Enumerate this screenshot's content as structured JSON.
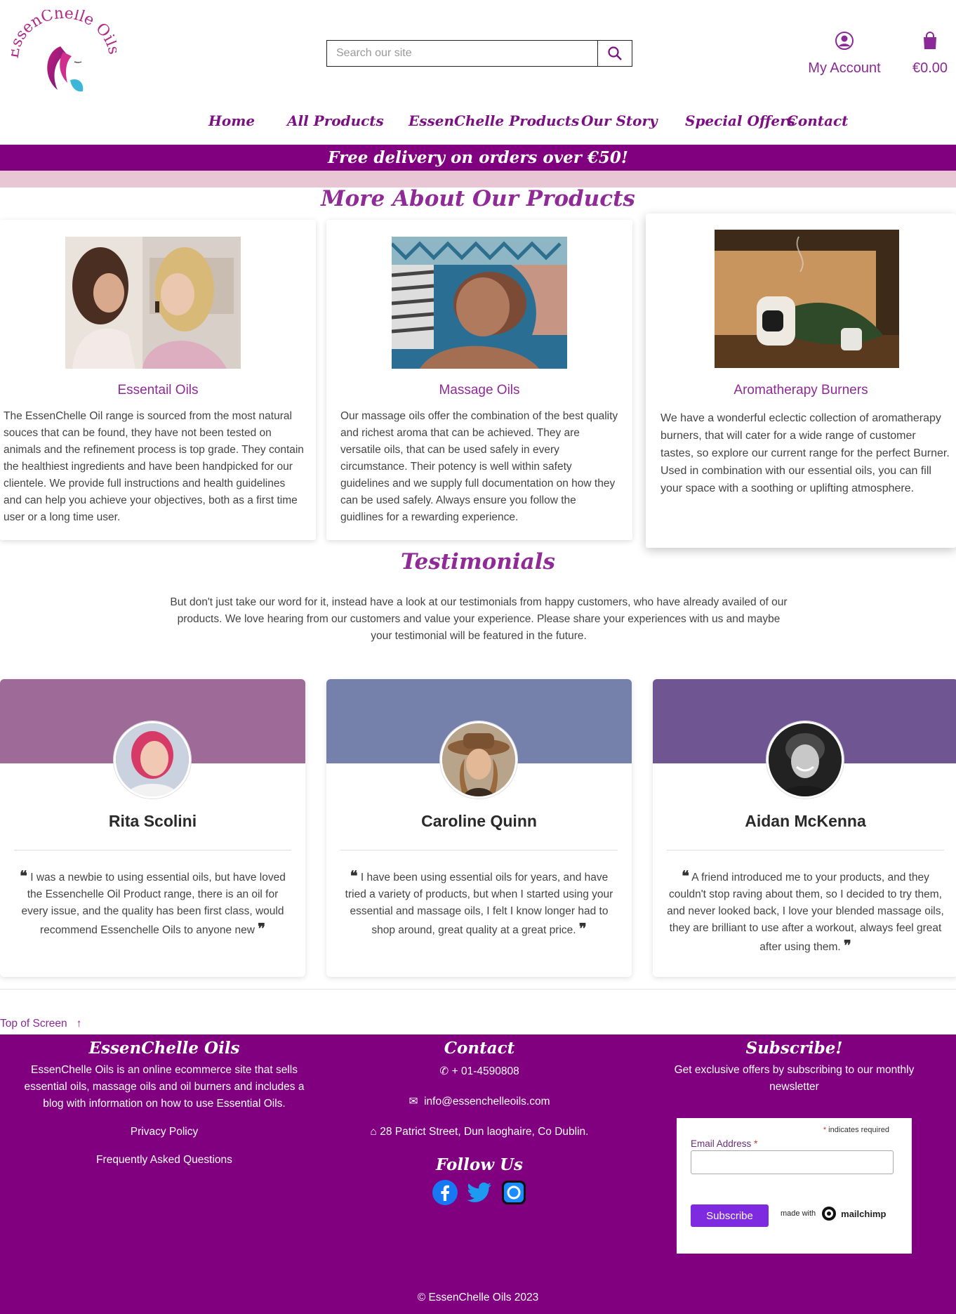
{
  "header": {
    "logo_text": "EssenChelle Oils",
    "search_placeholder": "Search our site",
    "account_label": "My Account",
    "cart_total": "€0.00"
  },
  "nav": [
    "Home",
    "All Products",
    "EssenChelle Products",
    "Our Story",
    "Special Offers",
    "Contact"
  ],
  "banner": "Free delivery on orders over €50!",
  "products": {
    "title": "More About Our Products",
    "items": [
      {
        "title": "Essentail Oils",
        "text": "The EssenChelle Oil range is sourced from the most natural souces that can be found, they have not been tested on animals and the refinement process is top grade. They contain the healthiest ingredients and have been handpicked for our clientele. We provide full instructions and health guidelines and can help you achieve your objectives, both as a first time user or a long time user."
      },
      {
        "title": "Massage Oils",
        "text": "Our massage oils offer the combination of the best quality and richest aroma that can be achieved. They are versatile oils, that can be used safely in every circumstance. Their potency is well within safety guidelines and we supply full documentation on how they can be used safely. Always ensure you follow the guidlines for a rewarding experience."
      },
      {
        "title": "Aromatherapy Burners",
        "text": "We have a wonderful eclectic collection of aromatherapy burners, that will cater for a wide range of customer tastes, so explore our current range for the perfect Burner. Used in combination with our essential oils, you can fill your space with a soothing or uplifting atmosphere."
      }
    ]
  },
  "testimonials": {
    "title": "Testimonials",
    "intro": "But don't just take our word for it, instead have a look at our testimonials from happy customers, who have already availed of our products. We love hearing from our customers and value your experience. Please share your experiences with us and maybe your testimonial will be featured in the future.",
    "items": [
      {
        "name": "Rita Scolini",
        "quote": "I was a newbie to using essential oils, but have loved the Essenchelle Oil Product range, there is an oil for every issue, and the quality has been first class, would recommend Essenchelle Oils to anyone new",
        "color": "#9e6a98"
      },
      {
        "name": "Caroline Quinn",
        "quote": "I have been using essential oils for years, and have tried a variety of products, but when I started using your essential and massage oils, I felt I know longer had to shop around, great quality at a great price.",
        "color": "#7681ab"
      },
      {
        "name": "Aidan McKenna",
        "quote": "A friend introduced me to your products, and they couldn't stop raving about them, so I decided to try them, and never looked back, I love your blended massage oils, they are brilliant to use after a workout, always feel great after using them.",
        "color": "#6f5693"
      }
    ]
  },
  "top_of_screen": "Top of Screen",
  "footer": {
    "about": {
      "title": "EssenChelle Oils",
      "text": "EssenChelle Oils is an online ecommerce site that sells essential oils, massage oils and oil burners and includes a blog with information on how to use Essential Oils.",
      "links": [
        "Privacy Policy",
        "Frequently Asked Questions"
      ]
    },
    "contact": {
      "title": "Contact",
      "phone": "+ 01-4590808",
      "email": "info@essenchelleoils.com",
      "address": "28 Patrict Street, Dun laoghaire, Co Dublin.",
      "follow_title": "Follow Us"
    },
    "subscribe": {
      "title": "Subscribe!",
      "text": "Get exclusive offers by subscribing to our monthly newsletter",
      "required_note": "indicates required",
      "email_label": "Email Address",
      "button": "Subscribe",
      "made_with": "made with",
      "brand": "mailchimp"
    },
    "copyright": "© EssenChelle Oils 2023"
  },
  "colors": {
    "brand_purple": "#800080",
    "accent_text": "#8f2a97",
    "pink_bar": "#e8c6d3"
  }
}
